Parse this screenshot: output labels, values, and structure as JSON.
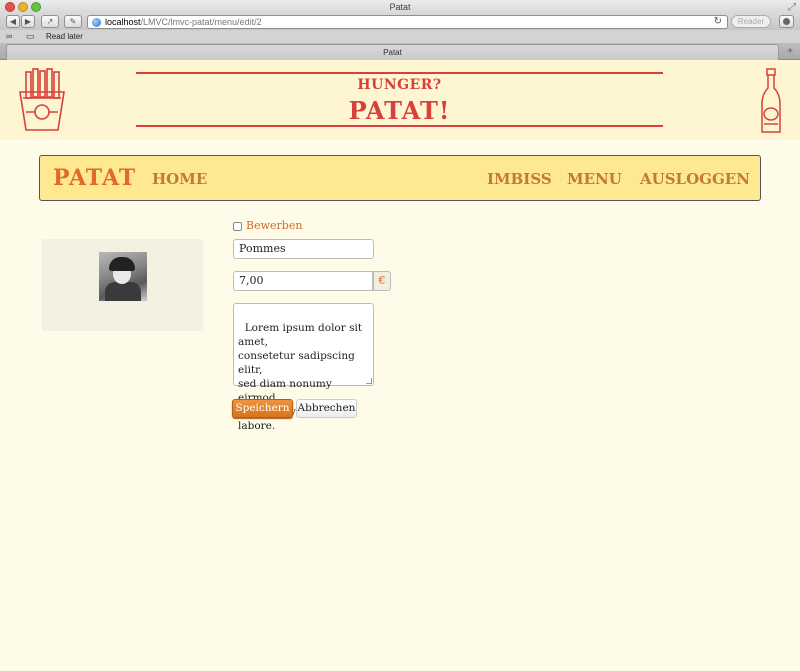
{
  "browser": {
    "window_title": "Patat",
    "url_host": "localhost",
    "url_path": "/LMVC/lmvc-patat/menu/edit/2",
    "reader_label": "Reader",
    "read_later_label": "Read later",
    "tab_title": "Patat"
  },
  "header": {
    "tagline": "HUNGER?",
    "title": "PATAT!"
  },
  "nav": {
    "brand": "PATAT",
    "home": "HOME",
    "imbiss": "IMBISS",
    "menu": "MENU",
    "logout": "AUSLOGGEN"
  },
  "form": {
    "promote_label": "Bewerben",
    "promote_checked": false,
    "name_value": "Pommes",
    "price_value": "7,00",
    "currency_symbol": "€",
    "description_value": "Lorem ipsum dolor sit amet,\nconsetetur sadipscing elitr,\nsed diam nonumy eirmod\ntempor invidunt ut labore.",
    "save_label": "Speichern",
    "cancel_label": "Abbrechen"
  },
  "colors": {
    "accent_red": "#d8403a",
    "accent_orange": "#e06b28",
    "nav_bg": "#fee891",
    "page_bg": "#fefbe9"
  }
}
